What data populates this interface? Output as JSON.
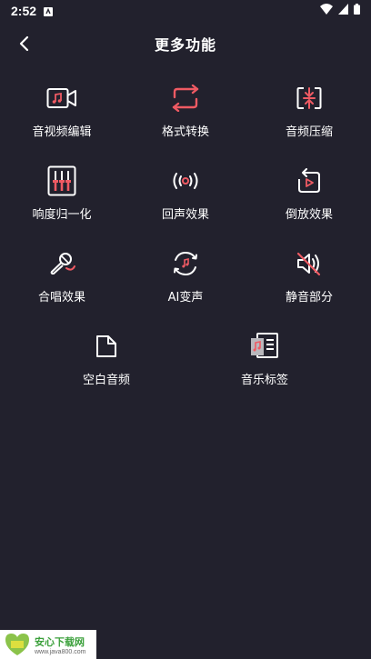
{
  "status": {
    "time": "2:52"
  },
  "header": {
    "title": "更多功能"
  },
  "features": [
    {
      "label": "音视频编辑",
      "icon": "video-music-icon"
    },
    {
      "label": "格式转换",
      "icon": "repeat-icon"
    },
    {
      "label": "音频压缩",
      "icon": "compress-icon"
    },
    {
      "label": "响度归一化",
      "icon": "equalizer-icon"
    },
    {
      "label": "回声效果",
      "icon": "echo-icon"
    },
    {
      "label": "倒放效果",
      "icon": "reverse-play-icon"
    },
    {
      "label": "合唱效果",
      "icon": "microphone-icon"
    },
    {
      "label": "AI变声",
      "icon": "ai-voice-icon"
    },
    {
      "label": "静音部分",
      "icon": "mute-icon"
    },
    {
      "label": "空白音频",
      "icon": "blank-file-icon"
    },
    {
      "label": "音乐标签",
      "icon": "music-tag-icon"
    }
  ],
  "watermark": {
    "main": "安心下载网",
    "sub": "www.java800.com",
    "logo_text": "安心下载"
  },
  "colors": {
    "background": "#22212d",
    "accent": "#ef5a63",
    "icon_stroke": "#ffffff"
  }
}
